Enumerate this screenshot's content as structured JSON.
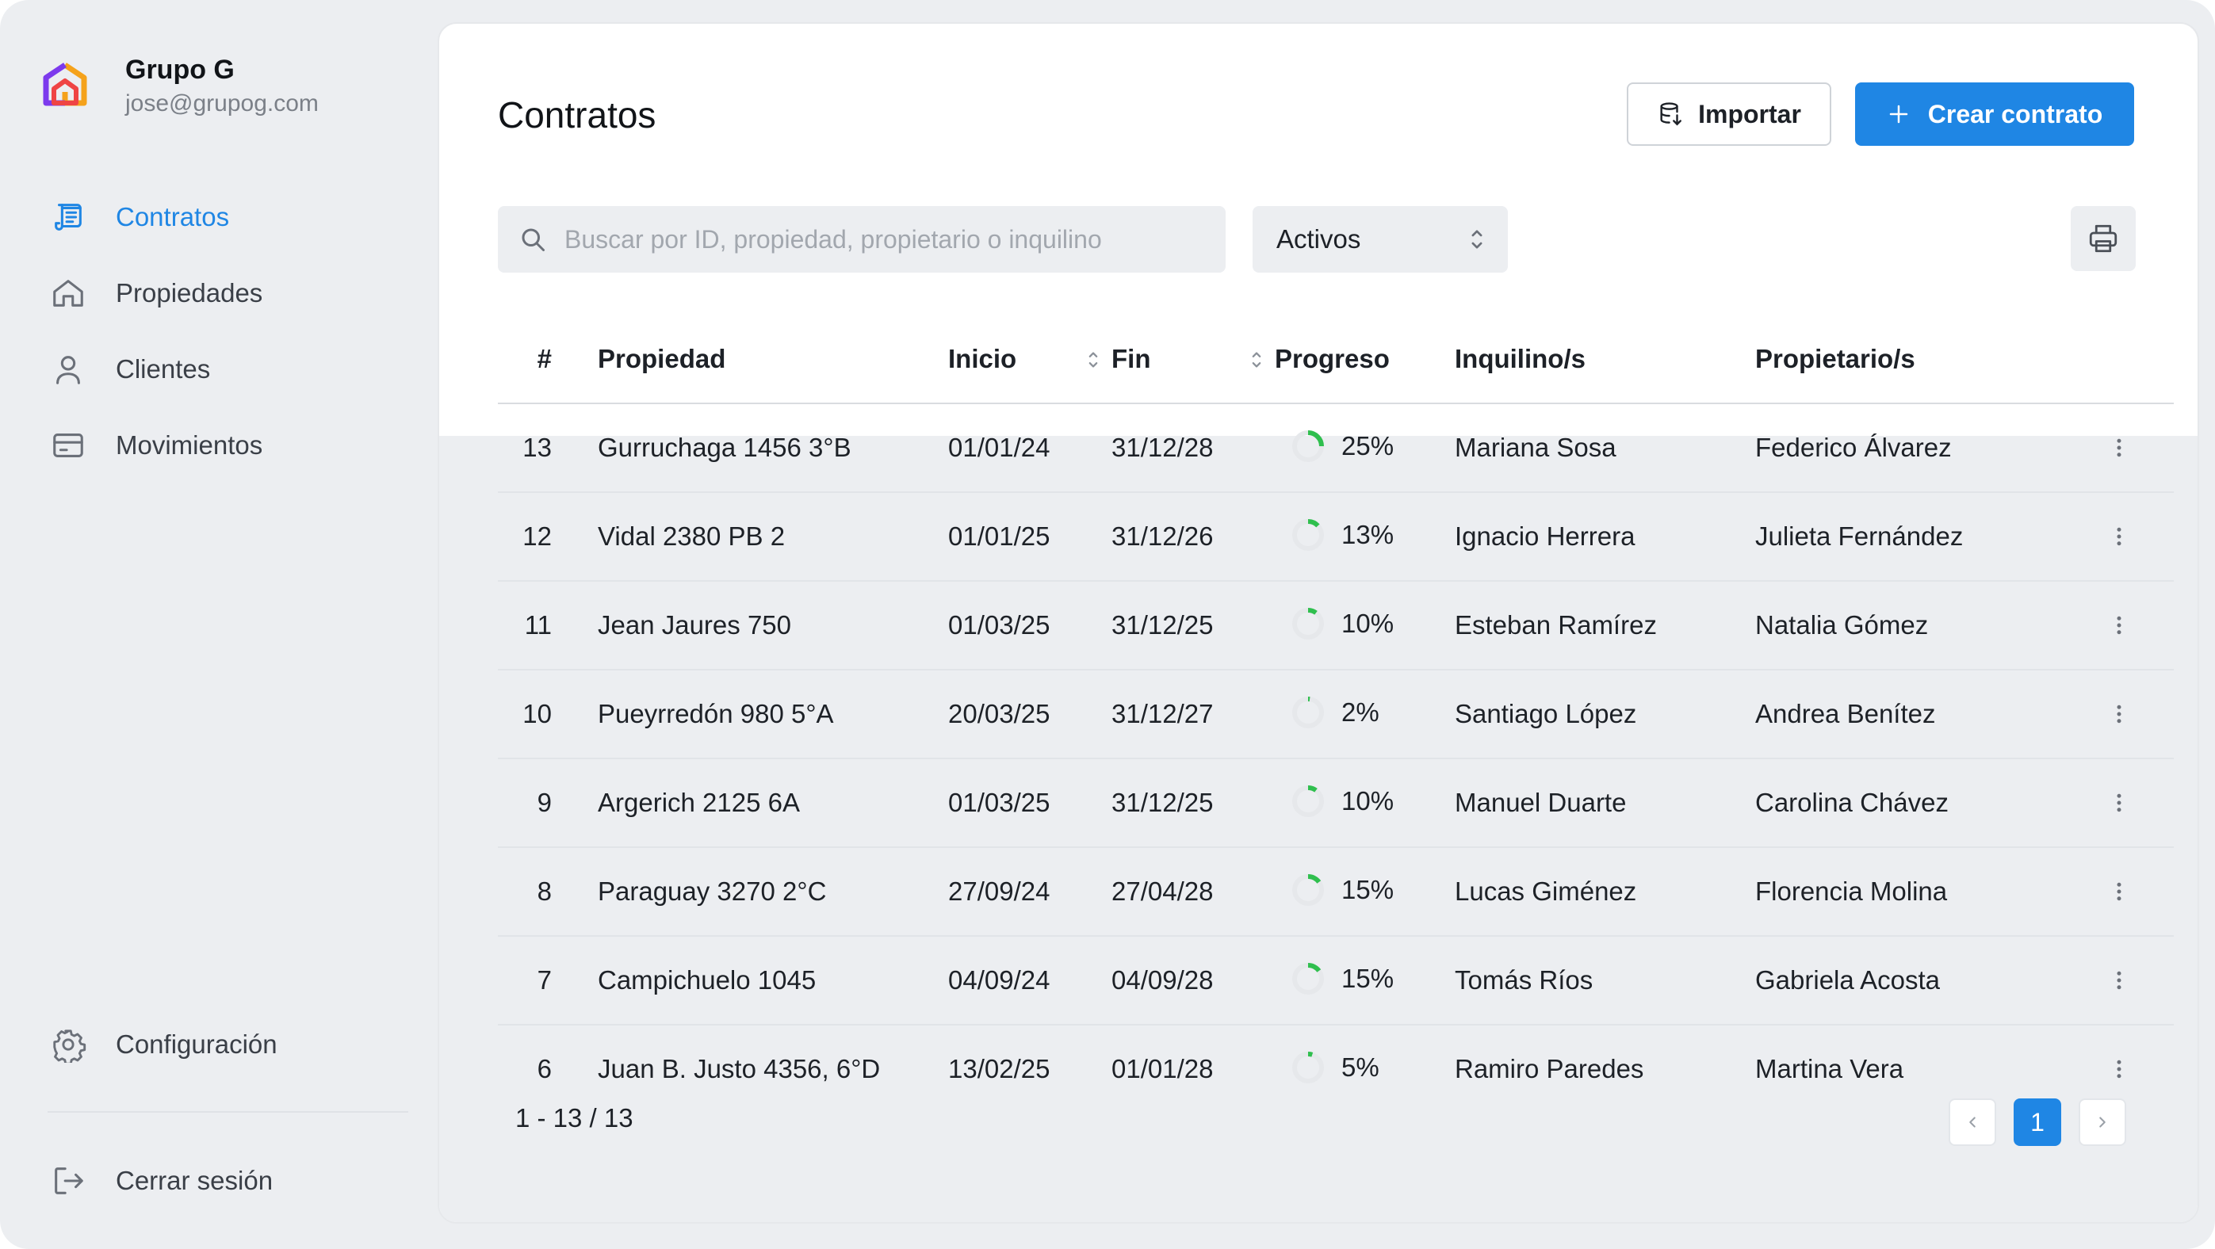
{
  "org": {
    "name": "Grupo G",
    "email": "jose@grupog.com"
  },
  "nav": {
    "items": [
      {
        "label": "Contratos",
        "icon": "document-icon",
        "active": true
      },
      {
        "label": "Propiedades",
        "icon": "home-icon",
        "active": false
      },
      {
        "label": "Clientes",
        "icon": "user-icon",
        "active": false
      },
      {
        "label": "Movimientos",
        "icon": "card-icon",
        "active": false
      }
    ],
    "settings": "Configuración",
    "logout": "Cerrar sesión"
  },
  "page": {
    "title": "Contratos",
    "import_label": "Importar",
    "create_label": "Crear contrato"
  },
  "filters": {
    "search_placeholder": "Buscar por ID, propiedad, propietario o inquilino",
    "status_selected": "Activos"
  },
  "table": {
    "headers": [
      "#",
      "Propiedad",
      "Inicio",
      "Fin",
      "Progreso",
      "Inquilino/s",
      "Propietario/s"
    ],
    "rows": [
      {
        "id": "13",
        "propiedad": "Gurruchaga 1456 3°B",
        "inicio": "01/01/24",
        "fin": "31/12/28",
        "progreso": "25%",
        "progress_value": 25,
        "inquilino": "Mariana Sosa",
        "propietario": "Federico Álvarez"
      },
      {
        "id": "12",
        "propiedad": "Vidal 2380 PB 2",
        "inicio": "01/01/25",
        "fin": "31/12/26",
        "progreso": "13%",
        "progress_value": 13,
        "inquilino": "Ignacio Herrera",
        "propietario": "Julieta Fernández"
      },
      {
        "id": "11",
        "propiedad": "Jean Jaures 750",
        "inicio": "01/03/25",
        "fin": "31/12/25",
        "progreso": "10%",
        "progress_value": 10,
        "inquilino": "Esteban Ramírez",
        "propietario": "Natalia Gómez"
      },
      {
        "id": "10",
        "propiedad": "Pueyrredón 980 5°A",
        "inicio": "20/03/25",
        "fin": "31/12/27",
        "progreso": "2%",
        "progress_value": 2,
        "inquilino": "Santiago López",
        "propietario": "Andrea Benítez"
      },
      {
        "id": "9",
        "propiedad": "Argerich 2125 6A",
        "inicio": "01/03/25",
        "fin": "31/12/25",
        "progreso": "10%",
        "progress_value": 10,
        "inquilino": "Manuel Duarte",
        "propietario": "Carolina Chávez"
      },
      {
        "id": "8",
        "propiedad": "Paraguay 3270 2°C",
        "inicio": "27/09/24",
        "fin": "27/04/28",
        "progreso": "15%",
        "progress_value": 15,
        "inquilino": "Lucas Giménez",
        "propietario": "Florencia Molina"
      },
      {
        "id": "7",
        "propiedad": "Campichuelo 1045",
        "inicio": "04/09/24",
        "fin": "04/09/28",
        "progreso": "15%",
        "progress_value": 15,
        "inquilino": "Tomás Ríos",
        "propietario": "Gabriela Acosta"
      },
      {
        "id": "6",
        "propiedad": "Juan B. Justo 4356, 6°D",
        "inicio": "13/02/25",
        "fin": "01/01/28",
        "progreso": "5%",
        "progress_value": 5,
        "inquilino": "Ramiro Paredes",
        "propietario": "Martina Vera"
      }
    ]
  },
  "pagination": {
    "summary": "1 - 13 / 13",
    "current_page": "1"
  },
  "colors": {
    "accent": "#1f86e4",
    "progress": "#2fbf4e",
    "track": "#e6e8eb"
  }
}
